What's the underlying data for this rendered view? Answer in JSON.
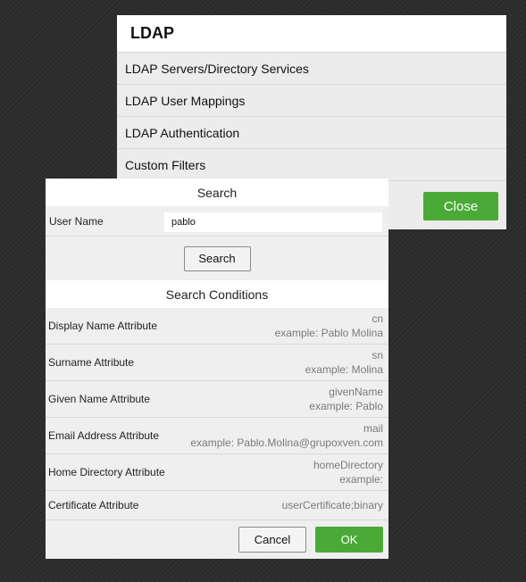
{
  "ldap": {
    "title": "LDAP",
    "items": [
      {
        "label": "LDAP Servers/Directory Services"
      },
      {
        "label": "LDAP User Mappings"
      },
      {
        "label": "LDAP Authentication"
      },
      {
        "label": "Custom Filters"
      }
    ],
    "close_label": "Close"
  },
  "dialog": {
    "search_title": "Search",
    "user_name_label": "User Name",
    "user_name_value": "pablo",
    "search_button": "Search",
    "conditions_title": "Search Conditions",
    "conditions": [
      {
        "label": "Display Name Attribute",
        "value": "cn",
        "example": "example: Pablo Molina"
      },
      {
        "label": "Surname Attribute",
        "value": "sn",
        "example": "example: Molina"
      },
      {
        "label": "Given Name Attribute",
        "value": "givenName",
        "example": "example: Pablo"
      },
      {
        "label": "Email Address Attribute",
        "value": "mail",
        "example": "example: Pablo.Molina@grupoxven.com"
      },
      {
        "label": "Home Directory Attribute",
        "value": "homeDirectory",
        "example": "example:"
      },
      {
        "label": "Certificate Attribute",
        "value": "userCertificate;binary"
      }
    ],
    "cancel_label": "Cancel",
    "ok_label": "OK"
  },
  "colors": {
    "accent_green": "#4aaa37",
    "background": "#2b2b2b",
    "panel": "#ececec"
  }
}
